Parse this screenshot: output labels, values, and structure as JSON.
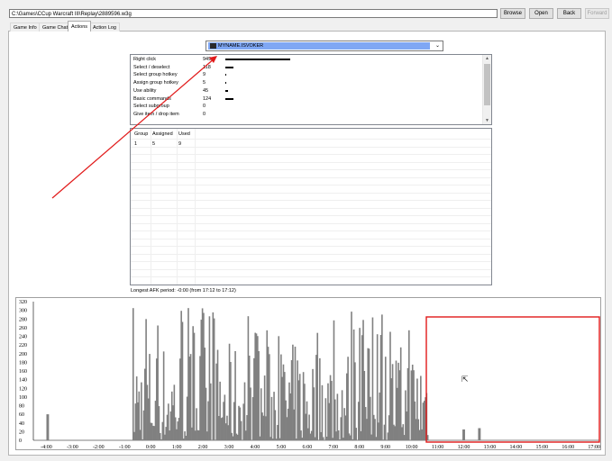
{
  "toolbar": {
    "path": "C:\\Games\\CCup Warcraft III\\Replay\\2889596.w3g",
    "browse": "Browse",
    "open": "Open",
    "back": "Back",
    "forward": "Forward"
  },
  "tabs": [
    {
      "label": "Game Info"
    },
    {
      "label": "Game Chat"
    },
    {
      "label": "Actions"
    },
    {
      "label": "Action Log"
    }
  ],
  "player_select": {
    "value": "MYNAME.ISVOKER"
  },
  "actions": {
    "rows": [
      {
        "label": "Right click",
        "value": "949",
        "fraction": 1.0
      },
      {
        "label": "Select / deselect",
        "value": "118",
        "fraction": 0.124
      },
      {
        "label": "Select group hotkey",
        "value": "9",
        "fraction": 0.0095
      },
      {
        "label": "Assign group hotkey",
        "value": "5",
        "fraction": 0.0053
      },
      {
        "label": "Use ability",
        "value": "45",
        "fraction": 0.047
      },
      {
        "label": "Basic commands",
        "value": "124",
        "fraction": 0.131
      },
      {
        "label": "Select subgroup",
        "value": "0",
        "fraction": 0
      },
      {
        "label": "Give item / drop item",
        "value": "0",
        "fraction": 0
      }
    ]
  },
  "groups": {
    "headers": [
      "Group",
      "Assigned",
      "Used"
    ],
    "rows": [
      [
        "1",
        "5",
        "9"
      ]
    ]
  },
  "afk_text": "Longest AFK period: -0:00 (from 17:12 to 17:12)",
  "chart_data": {
    "type": "bar",
    "x_ticks": [
      "-4:00",
      "-3:00",
      "-2:00",
      "-1:00",
      "0:00",
      "1:00",
      "2:00",
      "3:00",
      "4:00",
      "5:00",
      "6:00",
      "7:00",
      "8:00",
      "9:00",
      "10:00",
      "11:00",
      "12:00",
      "13:00",
      "14:00",
      "15:00",
      "16:00",
      "17:00"
    ],
    "y_ticks": [
      "0",
      "20",
      "40",
      "60",
      "80",
      "100",
      "120",
      "140",
      "160",
      "180",
      "200",
      "220",
      "240",
      "260",
      "280",
      "300",
      "320"
    ],
    "ylim": [
      0,
      320
    ],
    "xlim": [
      -4.5,
      17.2
    ],
    "bar_color": "#808080",
    "activity": [
      {
        "from": -4.0,
        "to": -3.95,
        "max": 60
      },
      {
        "from": -0.7,
        "to": 2.0,
        "max": 310
      },
      {
        "from": 2.0,
        "to": 10.6,
        "max": 300
      },
      {
        "from": 11.95,
        "to": 12.0,
        "max": 25
      },
      {
        "from": 12.55,
        "to": 12.6,
        "max": 28
      }
    ]
  },
  "annotations": {
    "color": "#e11a1a"
  }
}
